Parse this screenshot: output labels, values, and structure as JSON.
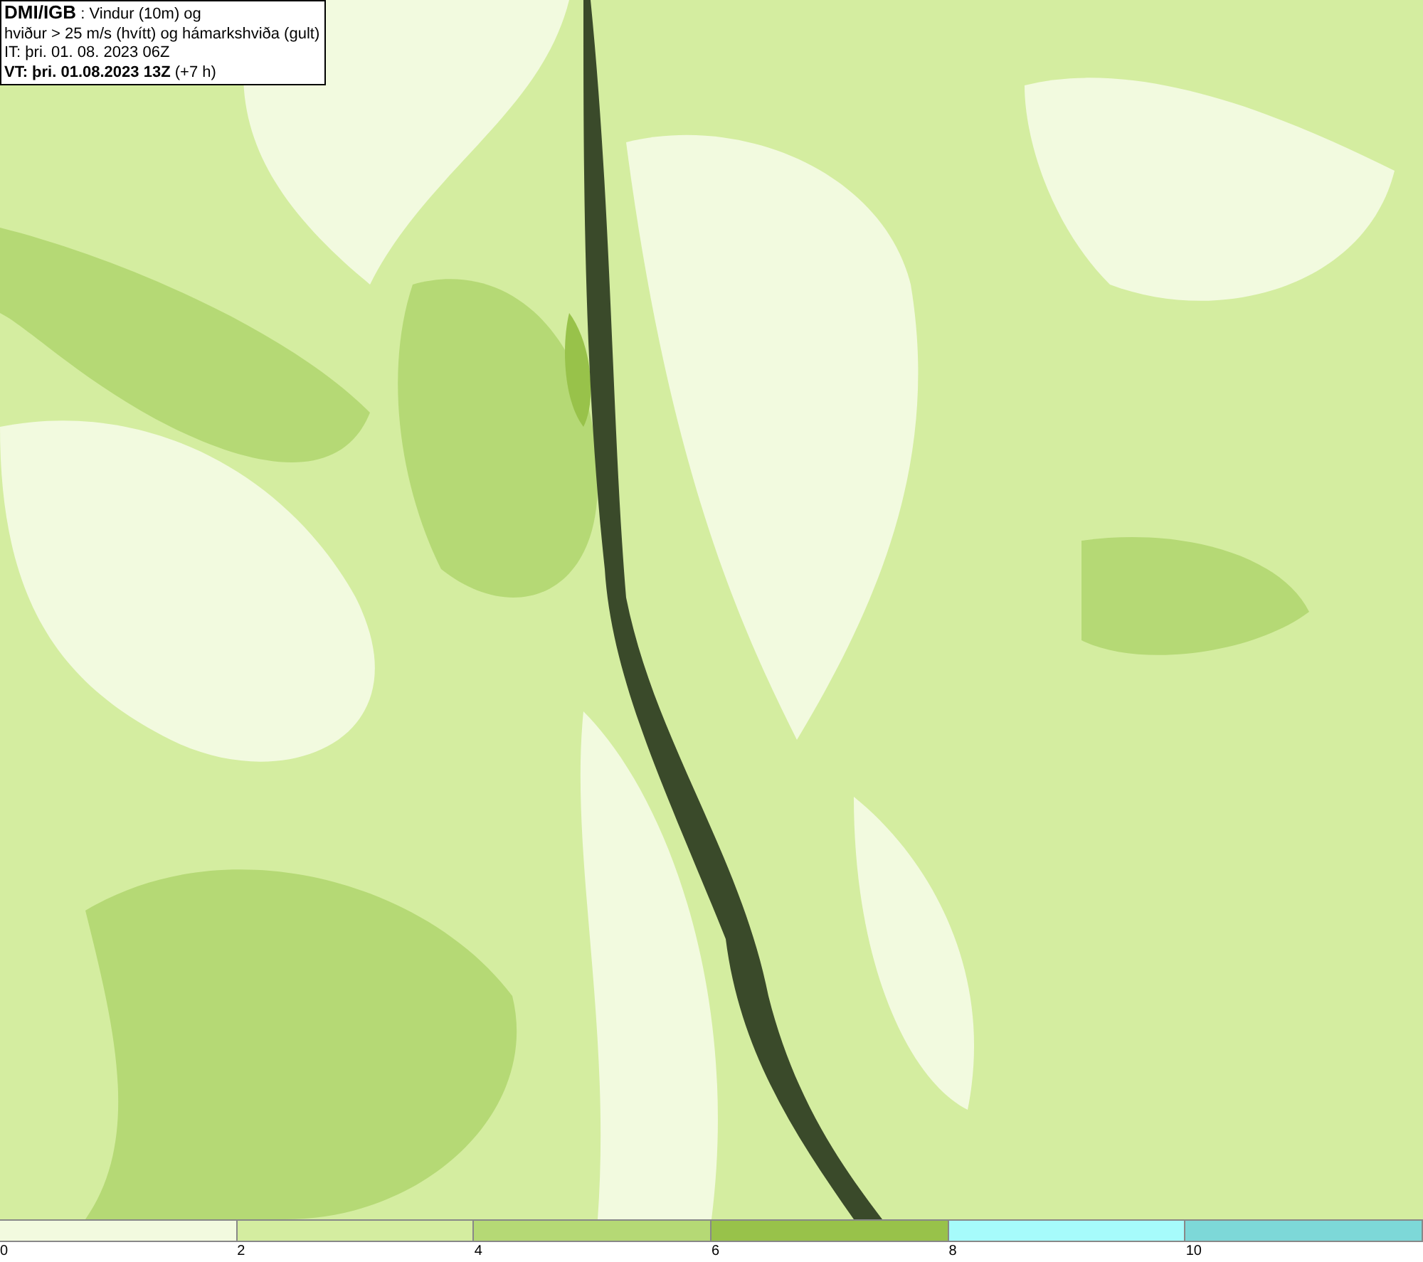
{
  "header": {
    "lines": [
      "**DMI/IGB** : Vindur (10m) og",
      "hviður > 25 m/s (hvítt) og hámarkshviða (gult)",
      "IT: þri. 01. 08. 2023 06Z",
      "**VT: þri. 01.08.2023 13Z** (+7 h)"
    ]
  },
  "legend": [
    {
      "label": "0",
      "color": "#f2fadf"
    },
    {
      "label": "2",
      "color": "#d4eda0"
    },
    {
      "label": "4",
      "color": "#b5d975"
    },
    {
      "label": "6",
      "color": "#98c24a"
    },
    {
      "label": "8",
      "color": "#a6fbfb"
    },
    {
      "label": "10",
      "color": "#7dd8d8"
    }
  ]
}
